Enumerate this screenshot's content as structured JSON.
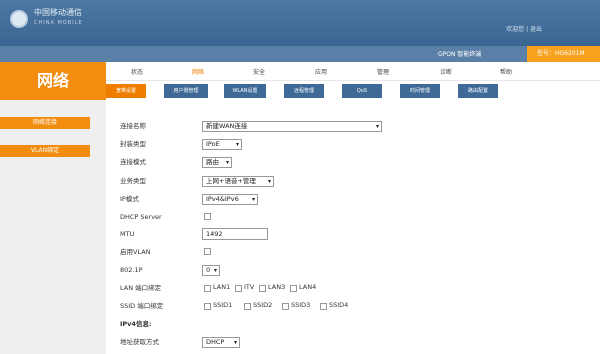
{
  "header": {
    "logo_cn": "中国移动通信",
    "logo_en": "CHINA MOBILE",
    "user_links": "欢迎您 | 退出",
    "gpon_label": "GPON 智能终端",
    "model_label": "型号：HG6201M"
  },
  "brand": "网络",
  "menu": {
    "items": [
      "状态",
      "网络",
      "安全",
      "应用",
      "管理",
      "诊断",
      "帮助"
    ],
    "active": "网络"
  },
  "submenu": {
    "items": [
      "宽带设置",
      "用户侧管理",
      "WLAN设置",
      "远程管理",
      "QoS",
      "时间管理",
      "路由配置"
    ],
    "active": "宽带设置"
  },
  "sidebar": {
    "items": [
      "网络连接",
      "VLAN绑定"
    ]
  },
  "form": {
    "conn_name_label": "连接名称",
    "conn_name_value": "新建WAN连接",
    "encap_label": "封装类型",
    "encap_value": "IPoE",
    "conn_mode_label": "连接模式",
    "conn_mode_value": "路由",
    "service_label": "业务类型",
    "service_value": "上网+语音+管理",
    "ipmode_label": "IP模式",
    "ipmode_value": "IPv4&IPv6",
    "dhcp_label": "DHCP Server",
    "mtu_label": "MTU",
    "mtu_value": "1492",
    "vlan_label": "启用VLAN",
    "p8021_label": "802.1P",
    "p8021_value": "0",
    "lan_label": "LAN 端口绑定",
    "lan_ports": [
      "LAN1",
      "ITV",
      "LAN3",
      "LAN4"
    ],
    "ssid_label": "SSID 端口绑定",
    "ssid_ports": [
      "SSID1",
      "SSID2",
      "SSID3",
      "SSID4"
    ],
    "ipv4_section": "IPv4信息:",
    "addr_label": "地址获取方式",
    "addr_value": "DHCP"
  }
}
